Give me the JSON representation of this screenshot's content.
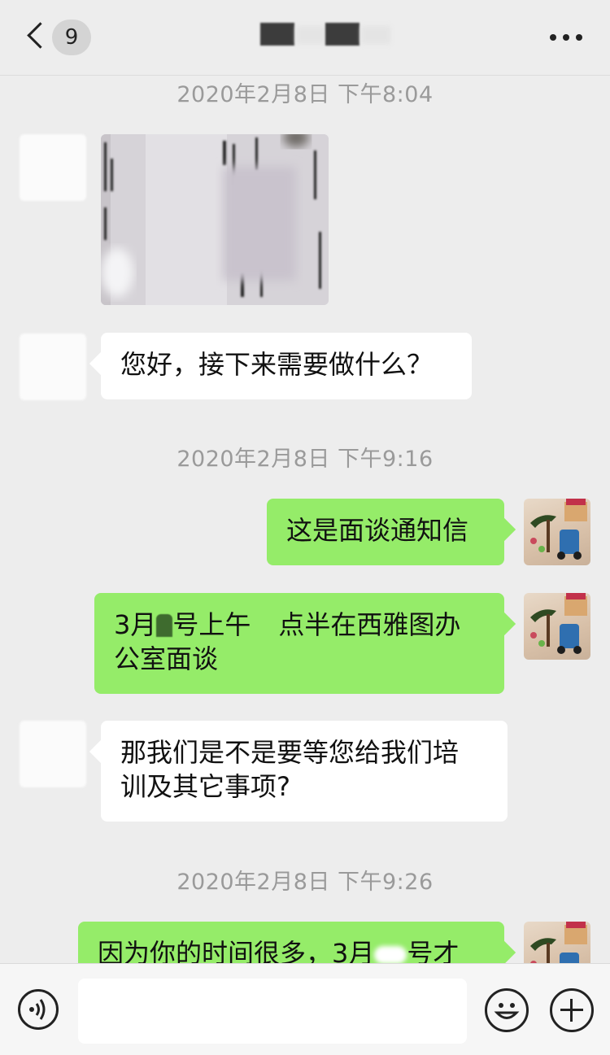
{
  "header": {
    "unread_count": "9"
  },
  "messages": {
    "ts1": "2020年2月8日 下午8:04",
    "m2": "您好，接下来需要做什么？",
    "ts2": "2020年2月8日 下午9:16",
    "m3": "这是面谈通知信",
    "m4_a": "3月",
    "m4_b": "号上午",
    "m4_c": "点半在西雅图办",
    "m4_d": "公室面谈",
    "m5_a": "那我们是不是要等您给我们培",
    "m5_b": "训及其它事项?",
    "ts3": "2020年2月8日 下午9:26",
    "m6_a": "因为你的时间很多，3月",
    "m6_b": "号才"
  },
  "colors": {
    "background": "#ededed",
    "incoming_bubble": "#ffffff",
    "outgoing_bubble": "#95ec69",
    "timestamp_text": "#9a9a9a"
  },
  "icons": [
    "back-chevron-icon",
    "more-icon",
    "voice-icon",
    "emoji-icon",
    "add-icon"
  ]
}
